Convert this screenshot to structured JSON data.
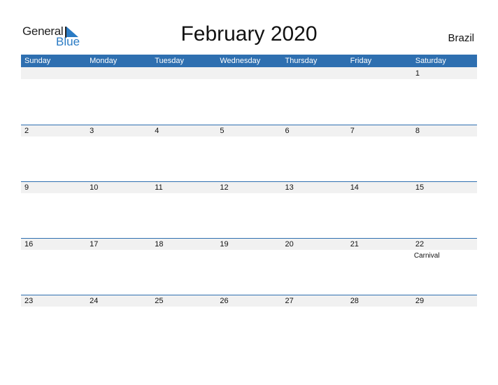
{
  "logo": {
    "word1": "General",
    "word2": "Blue"
  },
  "title": "February 2020",
  "country": "Brazil",
  "colors": {
    "accent": "#2e6fb0",
    "band": "#f1f1f1",
    "logo_blue": "#2a7bc4"
  },
  "weekdays": [
    "Sunday",
    "Monday",
    "Tuesday",
    "Wednesday",
    "Thursday",
    "Friday",
    "Saturday"
  ],
  "weeks": [
    [
      {
        "day": ""
      },
      {
        "day": ""
      },
      {
        "day": ""
      },
      {
        "day": ""
      },
      {
        "day": ""
      },
      {
        "day": ""
      },
      {
        "day": "1"
      }
    ],
    [
      {
        "day": "2"
      },
      {
        "day": "3"
      },
      {
        "day": "4"
      },
      {
        "day": "5"
      },
      {
        "day": "6"
      },
      {
        "day": "7"
      },
      {
        "day": "8"
      }
    ],
    [
      {
        "day": "9"
      },
      {
        "day": "10"
      },
      {
        "day": "11"
      },
      {
        "day": "12"
      },
      {
        "day": "13"
      },
      {
        "day": "14"
      },
      {
        "day": "15"
      }
    ],
    [
      {
        "day": "16"
      },
      {
        "day": "17"
      },
      {
        "day": "18"
      },
      {
        "day": "19"
      },
      {
        "day": "20"
      },
      {
        "day": "21"
      },
      {
        "day": "22",
        "event": "Carnival"
      }
    ],
    [
      {
        "day": "23"
      },
      {
        "day": "24"
      },
      {
        "day": "25"
      },
      {
        "day": "26"
      },
      {
        "day": "27"
      },
      {
        "day": "28"
      },
      {
        "day": "29"
      }
    ]
  ]
}
